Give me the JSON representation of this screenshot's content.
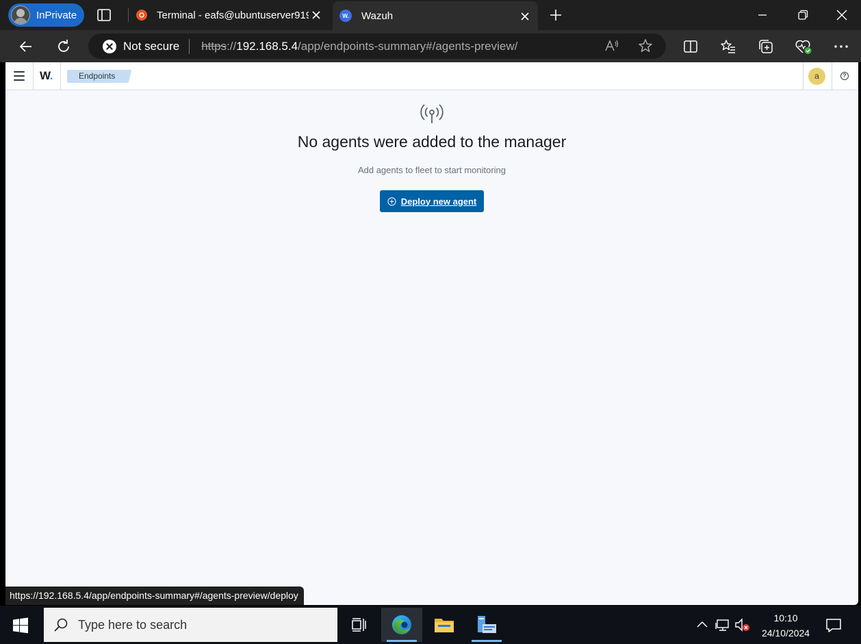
{
  "browser": {
    "inprivate_label": "InPrivate",
    "tabs": [
      {
        "title": "Terminal - eafs@ubuntuserver919",
        "favicon": "ubuntu-icon"
      },
      {
        "title": "Wazuh",
        "favicon": "wazuh-icon",
        "favicon_text": "W."
      }
    ],
    "address": {
      "security_label": "Not secure",
      "scheme": "https",
      "separator": "://",
      "host": "192.168.5.4",
      "path": "/app/endpoints-summary#/agents-preview/"
    },
    "status_url": "https://192.168.5.4/app/endpoints-summary#/agents-preview/deploy"
  },
  "app": {
    "logo": "W",
    "logo_dot": ".",
    "breadcrumb": "Endpoints",
    "user_initial": "a",
    "help_symbol": "?"
  },
  "empty_state": {
    "icon": "signal-icon",
    "title": "No agents were added to the manager",
    "subtitle": "Add agents to fleet to start monitoring",
    "button_label": "Deploy new agent"
  },
  "taskbar": {
    "search_placeholder": "Type here to search",
    "time": "10:10",
    "date": "24/10/2024"
  },
  "colors": {
    "accent": "#0061a6",
    "breadcrumb_bg": "#c5ddf2",
    "avatar_bg": "#e7cf6c",
    "inprivate": "#1b6ac9"
  }
}
